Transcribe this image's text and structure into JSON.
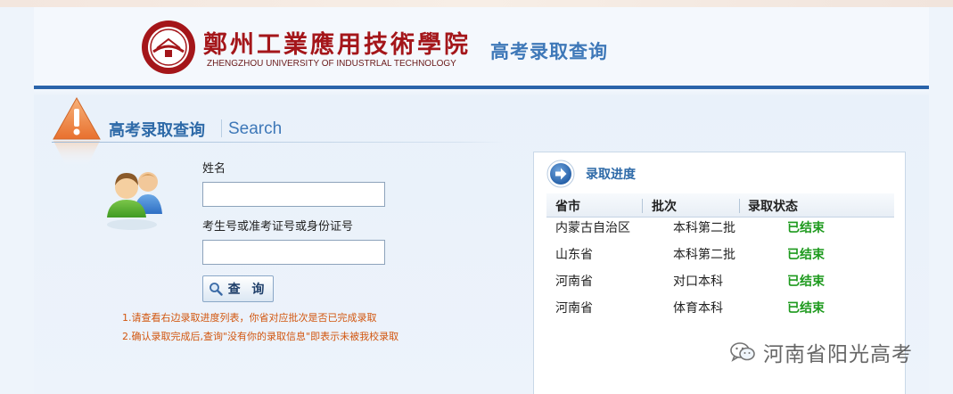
{
  "header": {
    "school_name_cn": "鄭州工業應用技術學院",
    "school_name_en": "ZHENGZHOU UNIVERSITY OF INDUSTRLAL TECHNOLOGY",
    "page_title": "高考录取查询"
  },
  "section": {
    "title": "高考录取查询",
    "subtitle": "Search"
  },
  "form": {
    "name_label": "姓名",
    "name_value": "",
    "id_label": "考生号或准考证号或身份证号",
    "id_value": "",
    "query_button_label": "查 询"
  },
  "notes": [
    "1.请查看右边录取进度列表，你省对应批次是否已完成录取",
    "2.确认录取完成后,查询\"没有你的录取信息\"即表示未被我校录取"
  ],
  "progress": {
    "title": "录取进度",
    "columns": [
      "省市",
      "批次",
      "录取状态"
    ],
    "rows": [
      {
        "province": "内蒙古自治区",
        "batch": "本科第二批",
        "status": "已结束"
      },
      {
        "province": "山东省",
        "batch": "本科第二批",
        "status": "已结束"
      },
      {
        "province": "河南省",
        "batch": "对口本科",
        "status": "已结束"
      },
      {
        "province": "河南省",
        "batch": "体育本科",
        "status": "已结束"
      }
    ]
  },
  "watermark": {
    "text": "河南省阳光高考"
  },
  "icons": {
    "seal": "school-seal-icon",
    "warning": "warning-icon",
    "users": "users-icon",
    "search": "magnifier-icon",
    "arrow": "arrow-right-circle-icon",
    "wechat": "wechat-icon"
  },
  "colors": {
    "accent_blue": "#2e6aa8",
    "header_rule": "#2a64aa",
    "school_red": "#a4161a",
    "note_orange": "#d2560f",
    "status_green": "#1e9a1e"
  }
}
